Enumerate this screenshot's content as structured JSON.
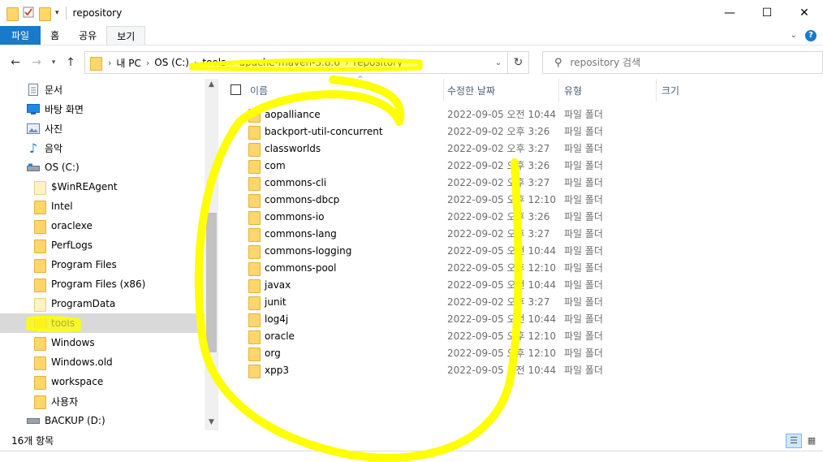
{
  "window": {
    "title": "repository",
    "minimize": "—",
    "maximize": "☐",
    "close": "✕"
  },
  "ribbon": {
    "tabs": [
      {
        "label": "파일"
      },
      {
        "label": "홈"
      },
      {
        "label": "공유"
      },
      {
        "label": "보기"
      }
    ]
  },
  "address": {
    "crumbs": [
      "내 PC",
      "OS (C:)",
      "tools",
      "apache-maven-3.8.6",
      "repository"
    ],
    "separator": "›"
  },
  "search": {
    "placeholder": "repository 검색"
  },
  "nav": {
    "items": [
      {
        "label": "문서",
        "icon": "document-icon"
      },
      {
        "label": "바탕 화면",
        "icon": "desktop-icon"
      },
      {
        "label": "사진",
        "icon": "pictures-icon"
      },
      {
        "label": "음악",
        "icon": "music-icon"
      },
      {
        "label": "OS (C:)",
        "icon": "drive-icon"
      },
      {
        "label": "$WinREAgent",
        "icon": "folder-icon"
      },
      {
        "label": "Intel",
        "icon": "folder-icon"
      },
      {
        "label": "oraclexe",
        "icon": "folder-icon"
      },
      {
        "label": "PerfLogs",
        "icon": "folder-icon"
      },
      {
        "label": "Program Files",
        "icon": "folder-icon"
      },
      {
        "label": "Program Files (x86)",
        "icon": "folder-icon"
      },
      {
        "label": "ProgramData",
        "icon": "folder-icon"
      },
      {
        "label": "tools",
        "icon": "folder-icon",
        "selected": true
      },
      {
        "label": "Windows",
        "icon": "folder-icon"
      },
      {
        "label": "Windows.old",
        "icon": "folder-icon"
      },
      {
        "label": "workspace",
        "icon": "folder-icon"
      },
      {
        "label": "사용자",
        "icon": "folder-icon"
      },
      {
        "label": "BACKUP (D:)",
        "icon": "drive-icon"
      }
    ]
  },
  "columns": {
    "name": "이름",
    "date": "수정한 날짜",
    "type": "유형",
    "size": "크기"
  },
  "files": [
    {
      "name": "aopalliance",
      "date": "2022-09-05 오전 10:44",
      "type": "파일 폴더"
    },
    {
      "name": "backport-util-concurrent",
      "date": "2022-09-02 오후 3:26",
      "type": "파일 폴더"
    },
    {
      "name": "classworlds",
      "date": "2022-09-02 오후 3:27",
      "type": "파일 폴더"
    },
    {
      "name": "com",
      "date": "2022-09-02 오후 3:26",
      "type": "파일 폴더"
    },
    {
      "name": "commons-cli",
      "date": "2022-09-02 오후 3:27",
      "type": "파일 폴더"
    },
    {
      "name": "commons-dbcp",
      "date": "2022-09-05 오후 12:10",
      "type": "파일 폴더"
    },
    {
      "name": "commons-io",
      "date": "2022-09-02 오후 3:26",
      "type": "파일 폴더"
    },
    {
      "name": "commons-lang",
      "date": "2022-09-02 오후 3:27",
      "type": "파일 폴더"
    },
    {
      "name": "commons-logging",
      "date": "2022-09-05 오전 10:44",
      "type": "파일 폴더"
    },
    {
      "name": "commons-pool",
      "date": "2022-09-05 오후 12:10",
      "type": "파일 폴더"
    },
    {
      "name": "javax",
      "date": "2022-09-05 오전 10:44",
      "type": "파일 폴더"
    },
    {
      "name": "junit",
      "date": "2022-09-02 오후 3:27",
      "type": "파일 폴더"
    },
    {
      "name": "log4j",
      "date": "2022-09-05 오전 10:44",
      "type": "파일 폴더"
    },
    {
      "name": "oracle",
      "date": "2022-09-05 오후 12:10",
      "type": "파일 폴더"
    },
    {
      "name": "org",
      "date": "2022-09-05 오후 12:10",
      "type": "파일 폴더"
    },
    {
      "name": "xpp3",
      "date": "2022-09-05 오전 10:44",
      "type": "파일 폴더"
    }
  ],
  "status": {
    "item_count": "16개 항목"
  },
  "colors": {
    "accent": "#1979ca",
    "highlighter": "#ffff00",
    "selection": "#d9d9d9"
  }
}
